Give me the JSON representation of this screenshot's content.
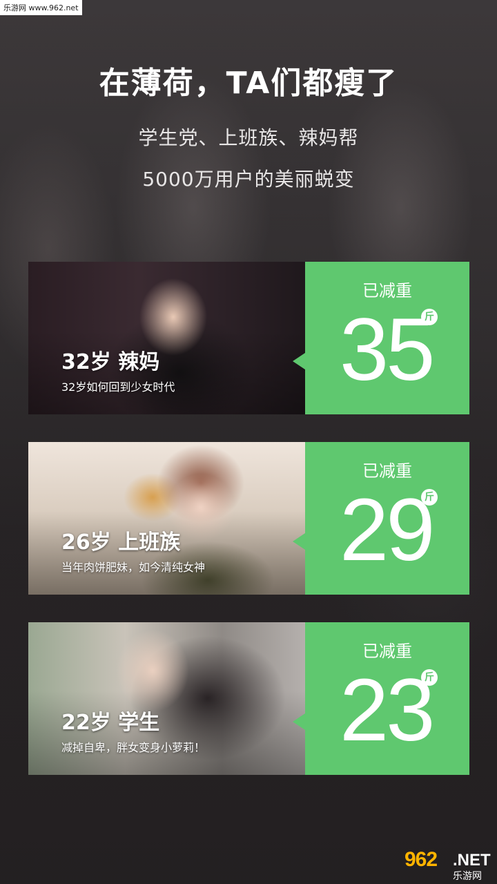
{
  "watermark_top": "乐游网 www.962.net",
  "headline": "在薄荷，TA们都瘦了",
  "subtitle_line1": "学生党、上班族、辣妈帮",
  "subtitle_line2": "5000万用户的美丽蜕变",
  "cards": [
    {
      "title": "32岁  辣妈",
      "desc": "32岁如何回到少女时代",
      "lost_label": "已减重",
      "lost_value": "35",
      "unit": "斤"
    },
    {
      "title": "26岁  上班族",
      "desc": "当年肉饼肥妹，如今清纯女神",
      "lost_label": "已减重",
      "lost_value": "29",
      "unit": "斤"
    },
    {
      "title": "22岁  学生",
      "desc": "减掉自卑，胖女变身小萝莉！",
      "lost_label": "已减重",
      "lost_value": "23",
      "unit": "斤"
    }
  ],
  "watermark_bottom": {
    "main": "962",
    "net": ".NET",
    "sub": "乐游网"
  },
  "colors": {
    "accent_green": "#5fc86f",
    "background": "#2e2a2c",
    "text": "#ffffff"
  }
}
